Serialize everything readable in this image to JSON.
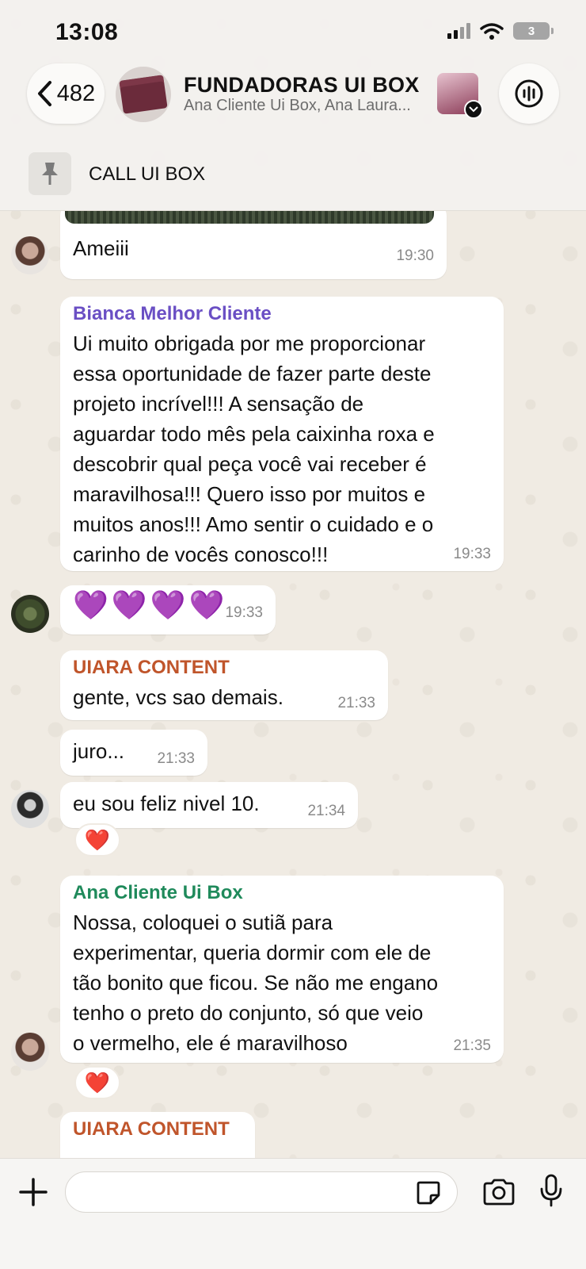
{
  "status_bar": {
    "time": "13:08",
    "battery": "3"
  },
  "header": {
    "back_count": "482",
    "group_name": "FUNDADORAS UI BOX",
    "members_preview": "Ana Cliente Ui Box, Ana Laura...",
    "pinned_label": "CALL UI BOX"
  },
  "messages": [
    {
      "sender": "",
      "text": "Ameiii",
      "time": "19:30"
    },
    {
      "sender": "Bianca Melhor Cliente",
      "sender_color": "#6a4fc4",
      "text": "Ui muito obrigada por me proporcionar\nessa oportunidade de fazer parte deste\nprojeto incrível!!! A sensação de\naguardar todo mês pela caixinha roxa e\ndescobrir qual peça você vai receber é\nmaravilhosa!!! Quero isso por muitos e\nmuitos anos!!! Amo sentir o cuidado e o\ncarinho de vocês conosco!!!",
      "time": "19:33"
    },
    {
      "sender": "",
      "text": "💜💜💜💜",
      "time": "19:33"
    },
    {
      "sender": "UIARA CONTENT",
      "sender_color": "#c0552b",
      "text": "gente, vcs sao demais.",
      "time": "21:33"
    },
    {
      "sender": "",
      "text": "juro...",
      "time": "21:33"
    },
    {
      "sender": "",
      "text": "eu sou feliz nivel 10.",
      "time": "21:34",
      "reaction": "❤️"
    },
    {
      "sender": "Ana Cliente Ui Box",
      "sender_color": "#1f8a5b",
      "text": "Nossa, coloquei o sutiã para\nexperimentar, queria dormir com ele de\ntão bonito que ficou. Se não me engano\ntenho o preto do conjunto, só que veio\no vermelho, ele é maravilhoso",
      "time": "21:35",
      "reaction": "❤️"
    },
    {
      "sender": "UIARA CONTENT",
      "sender_color": "#c0552b",
      "text": "",
      "time": ""
    }
  ],
  "composer": {
    "placeholder": ""
  },
  "icons": {
    "back": "chevron-left-icon",
    "call": "audio-waveform-icon",
    "pin": "pin-icon",
    "plus": "plus-icon",
    "sticker": "sticker-icon",
    "camera": "camera-icon",
    "mic": "microphone-icon"
  }
}
